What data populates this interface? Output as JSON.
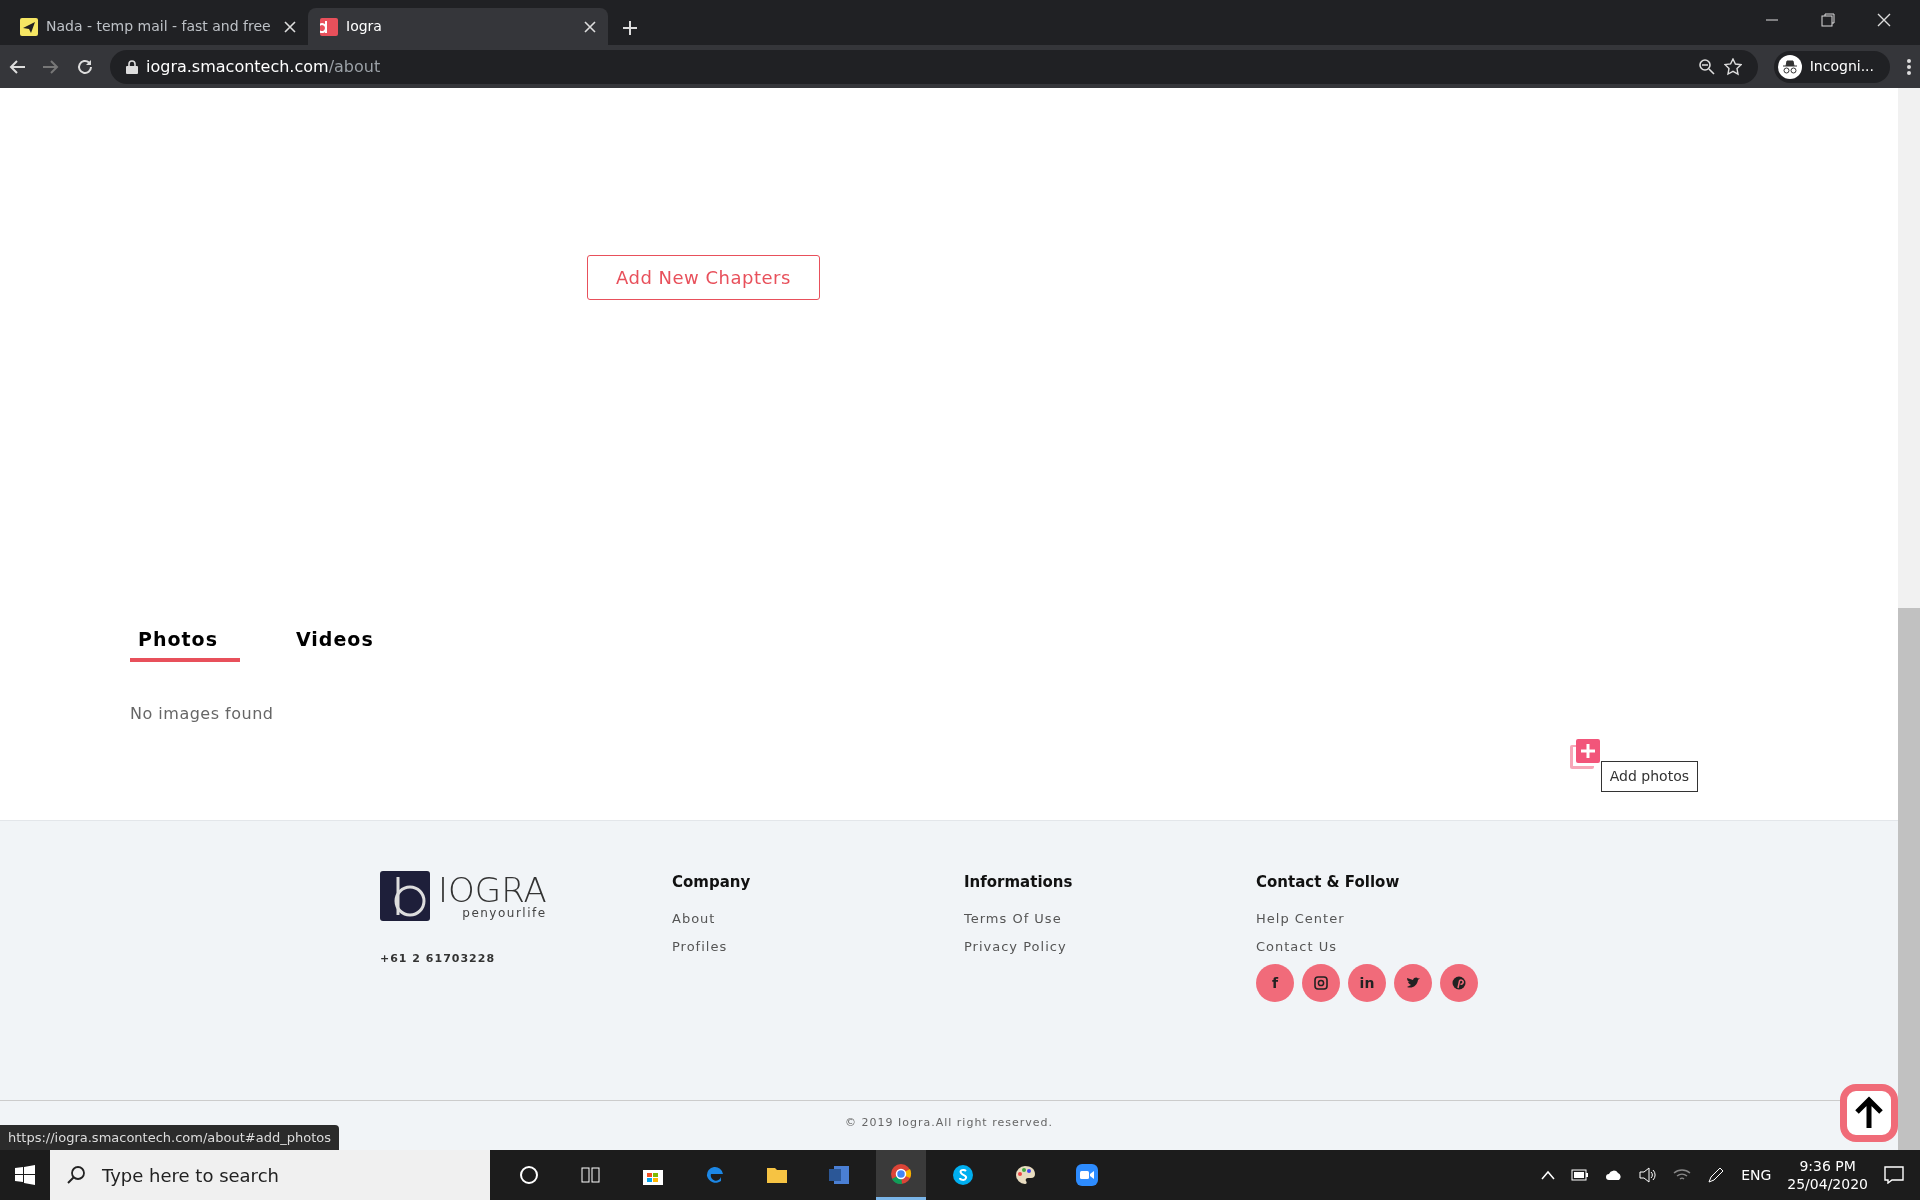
{
  "browser": {
    "tabs": [
      {
        "title": "Nada - temp mail - fast and free",
        "selected": false
      },
      {
        "title": "Iogra",
        "selected": true
      }
    ],
    "address": {
      "host": "iogra.smacontech.com",
      "path": "/about"
    },
    "profile": "Incogni..."
  },
  "page": {
    "chapter_button": "Add New Chapters",
    "media_tabs": [
      {
        "label": "Photos",
        "selected": true
      },
      {
        "label": "Videos",
        "selected": false
      }
    ],
    "empty_message": "No images found",
    "add_photos_tooltip": "Add photos"
  },
  "footer": {
    "logo": {
      "name": "IOGRA",
      "tagline": "penyourlife"
    },
    "phone": "+61 2 61703228",
    "columns": [
      {
        "heading": "Company",
        "links": [
          "About",
          "Profiles"
        ]
      },
      {
        "heading": "Informations",
        "links": [
          "Terms Of Use",
          "Privacy Policy"
        ]
      },
      {
        "heading": "Contact & Follow",
        "links": [
          "Help Center",
          "Contact Us"
        ]
      }
    ],
    "social": [
      {
        "kind": "letter",
        "glyph": "f"
      },
      {
        "kind": "camera"
      },
      {
        "kind": "letter",
        "glyph": "in"
      },
      {
        "kind": "bird"
      },
      {
        "kind": "pin"
      }
    ],
    "copyright": "© 2019 Iogra.All right reserved."
  },
  "status_url": "https://iogra.smacontech.com/about#add_photos",
  "taskbar": {
    "search_placeholder": "Type here to search",
    "apps": [
      {
        "kind": "circle",
        "active": false
      },
      {
        "kind": "taskview",
        "active": false
      },
      {
        "kind": "store",
        "active": false
      },
      {
        "kind": "edge",
        "active": false
      },
      {
        "kind": "folder",
        "active": false
      },
      {
        "kind": "word",
        "active": false
      },
      {
        "kind": "chrome",
        "active": true
      },
      {
        "kind": "skype",
        "active": false
      },
      {
        "kind": "paint",
        "active": false
      },
      {
        "kind": "zoom",
        "active": false
      }
    ],
    "language": "ENG",
    "time": "9:36 PM",
    "date": "25/04/2020"
  }
}
